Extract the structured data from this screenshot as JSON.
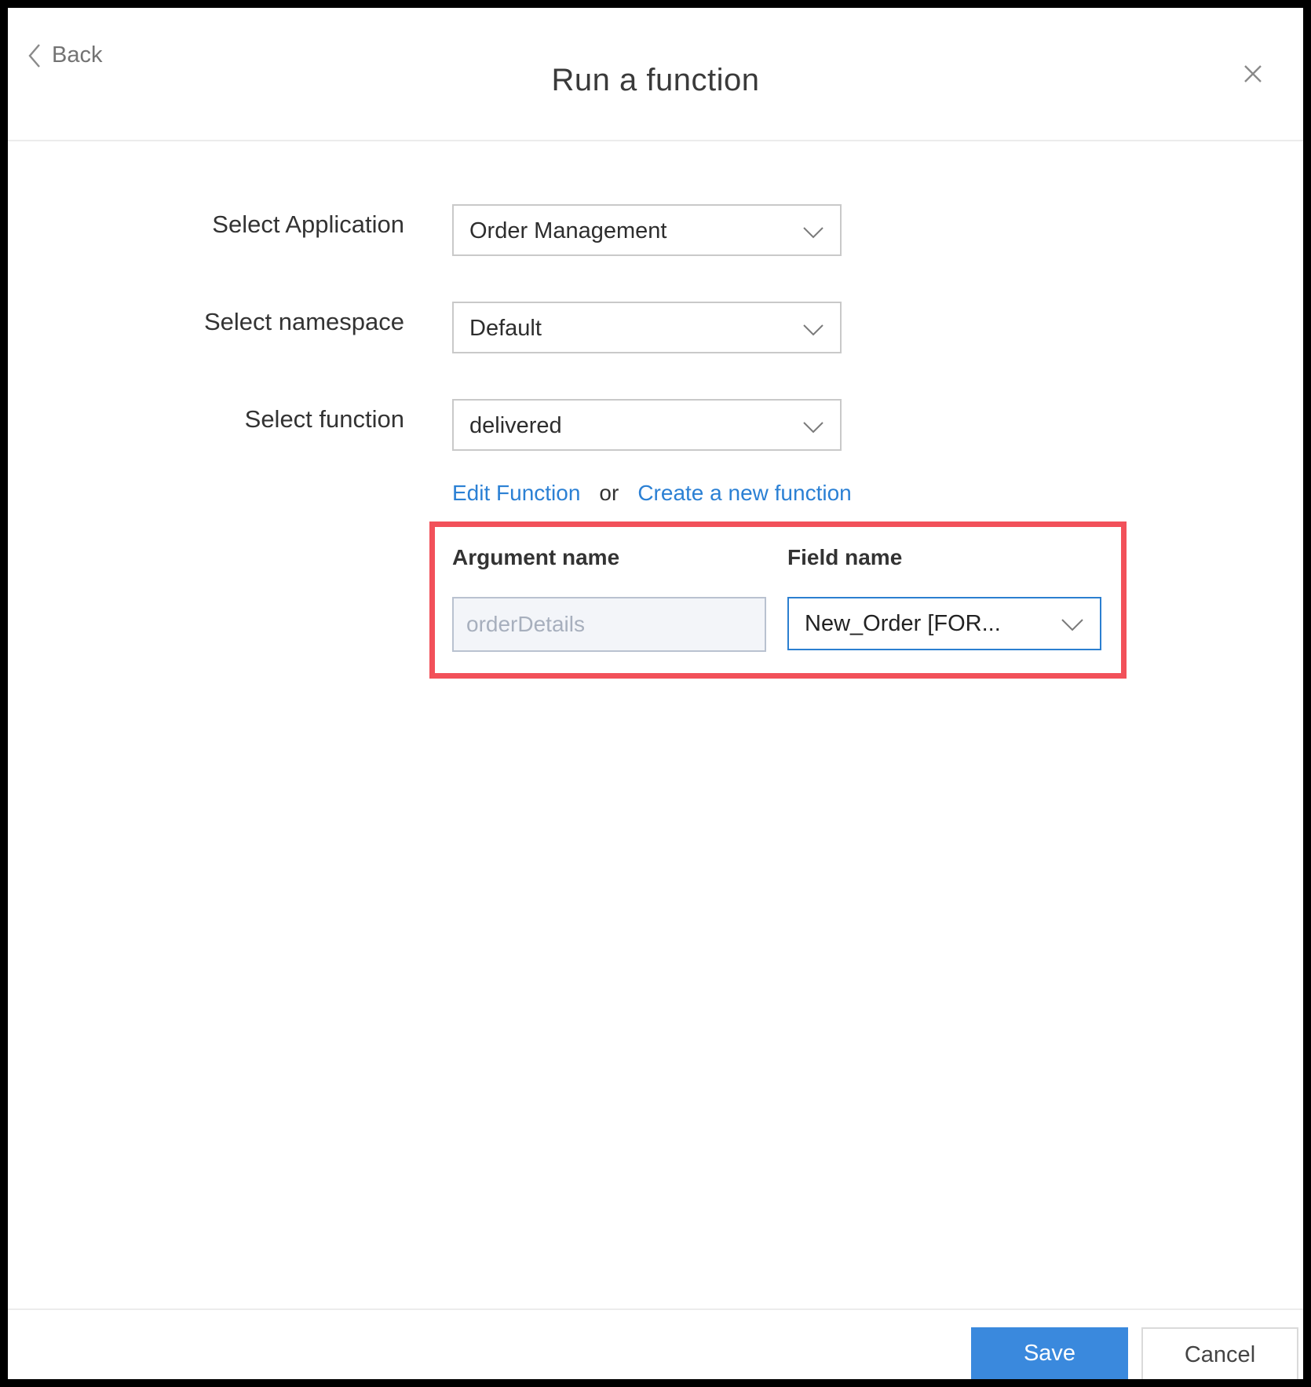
{
  "header": {
    "back_label": "Back",
    "title": "Run a function"
  },
  "form": {
    "application": {
      "label": "Select Application",
      "value": "Order Management"
    },
    "namespace": {
      "label": "Select namespace",
      "value": "Default"
    },
    "function": {
      "label": "Select function",
      "value": "delivered"
    }
  },
  "links": {
    "edit": "Edit Function",
    "separator": "or",
    "create": "Create a new function"
  },
  "mapping": {
    "argument_header": "Argument name",
    "field_header": "Field name",
    "argument_value": "orderDetails",
    "field_value": "New_Order [FOR..."
  },
  "footer": {
    "save_label": "Save",
    "cancel_label": "Cancel"
  },
  "colors": {
    "accent": "#3a89dd",
    "link": "#2b80d4",
    "highlight": "#f2515a"
  }
}
